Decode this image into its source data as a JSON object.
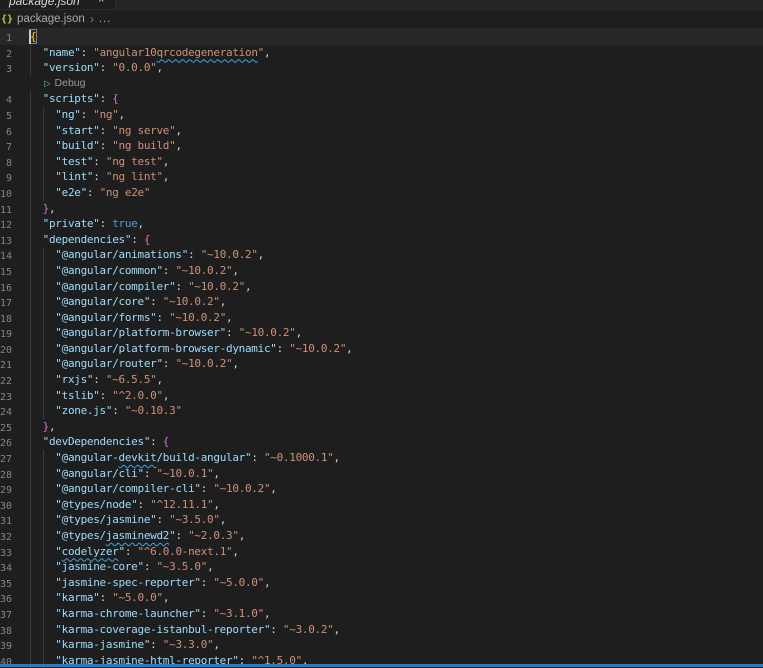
{
  "window": {
    "background": "#1e1e1e"
  },
  "tab_bar": {
    "tabs": [
      {
        "title": "package.json",
        "close_icon": "×",
        "active": true,
        "preview_italic": true
      }
    ]
  },
  "breadcrumb": {
    "file_icon": "{}",
    "file_name": "package.json",
    "separator": "›",
    "symbol_ellipsis": "..."
  },
  "codelens": {
    "icon": "▷",
    "label": "Debug"
  },
  "editor": {
    "language": "json",
    "rows": [
      {
        "t": "code",
        "n": "1",
        "g": 0,
        "cur": true,
        "tk": [
          [
            "b1 match",
            "{"
          ]
        ]
      },
      {
        "t": "code",
        "n": "2",
        "g": 1,
        "tk": [
          [
            "w",
            "  "
          ],
          [
            "k",
            "\"name\""
          ],
          [
            "p",
            ": "
          ],
          [
            "s",
            "\"angular10"
          ],
          [
            "s sq",
            "qrcodegeneration"
          ],
          [
            "s",
            "\""
          ],
          [
            "p",
            ","
          ]
        ]
      },
      {
        "t": "code",
        "n": "3",
        "g": 1,
        "tk": [
          [
            "w",
            "  "
          ],
          [
            "k",
            "\"version\""
          ],
          [
            "p",
            ": "
          ],
          [
            "s",
            "\"0.0.0\""
          ],
          [
            "p",
            ","
          ]
        ]
      },
      {
        "t": "lens"
      },
      {
        "t": "code",
        "n": "4",
        "g": 1,
        "tk": [
          [
            "w",
            "  "
          ],
          [
            "k",
            "\"scripts\""
          ],
          [
            "p",
            ": "
          ],
          [
            "b2",
            "{"
          ]
        ]
      },
      {
        "t": "code",
        "n": "5",
        "g": 2,
        "tk": [
          [
            "w",
            "    "
          ],
          [
            "k",
            "\"ng\""
          ],
          [
            "p",
            ": "
          ],
          [
            "s",
            "\"ng\""
          ],
          [
            "p",
            ","
          ]
        ]
      },
      {
        "t": "code",
        "n": "6",
        "g": 2,
        "tk": [
          [
            "w",
            "    "
          ],
          [
            "k",
            "\"start\""
          ],
          [
            "p",
            ": "
          ],
          [
            "s",
            "\"ng serve\""
          ],
          [
            "p",
            ","
          ]
        ]
      },
      {
        "t": "code",
        "n": "7",
        "g": 2,
        "tk": [
          [
            "w",
            "    "
          ],
          [
            "k",
            "\"build\""
          ],
          [
            "p",
            ": "
          ],
          [
            "s",
            "\"ng build\""
          ],
          [
            "p",
            ","
          ]
        ]
      },
      {
        "t": "code",
        "n": "8",
        "g": 2,
        "tk": [
          [
            "w",
            "    "
          ],
          [
            "k",
            "\"test\""
          ],
          [
            "p",
            ": "
          ],
          [
            "s",
            "\"ng test\""
          ],
          [
            "p",
            ","
          ]
        ]
      },
      {
        "t": "code",
        "n": "9",
        "g": 2,
        "tk": [
          [
            "w",
            "    "
          ],
          [
            "k",
            "\"lint\""
          ],
          [
            "p",
            ": "
          ],
          [
            "s",
            "\"ng lint\""
          ],
          [
            "p",
            ","
          ]
        ]
      },
      {
        "t": "code",
        "n": "10",
        "g": 2,
        "tk": [
          [
            "w",
            "    "
          ],
          [
            "k",
            "\"e2e\""
          ],
          [
            "p",
            ": "
          ],
          [
            "s",
            "\"ng e2e\""
          ]
        ]
      },
      {
        "t": "code",
        "n": "11",
        "g": 1,
        "tk": [
          [
            "w",
            "  "
          ],
          [
            "b2",
            "}"
          ],
          [
            "p",
            ","
          ]
        ]
      },
      {
        "t": "code",
        "n": "12",
        "g": 1,
        "tk": [
          [
            "w",
            "  "
          ],
          [
            "k",
            "\"private\""
          ],
          [
            "p",
            ": "
          ],
          [
            "b",
            "true"
          ],
          [
            "p",
            ","
          ]
        ]
      },
      {
        "t": "code",
        "n": "13",
        "g": 1,
        "tk": [
          [
            "w",
            "  "
          ],
          [
            "k",
            "\"dependencies\""
          ],
          [
            "p",
            ": "
          ],
          [
            "b2",
            "{"
          ]
        ]
      },
      {
        "t": "code",
        "n": "14",
        "g": 2,
        "tk": [
          [
            "w",
            "    "
          ],
          [
            "k",
            "\"@angular/animations\""
          ],
          [
            "p",
            ": "
          ],
          [
            "s",
            "\"~10.0.2\""
          ],
          [
            "p",
            ","
          ]
        ]
      },
      {
        "t": "code",
        "n": "15",
        "g": 2,
        "tk": [
          [
            "w",
            "    "
          ],
          [
            "k",
            "\"@angular/common\""
          ],
          [
            "p",
            ": "
          ],
          [
            "s",
            "\"~10.0.2\""
          ],
          [
            "p",
            ","
          ]
        ]
      },
      {
        "t": "code",
        "n": "16",
        "g": 2,
        "tk": [
          [
            "w",
            "    "
          ],
          [
            "k",
            "\"@angular/compiler\""
          ],
          [
            "p",
            ": "
          ],
          [
            "s",
            "\"~10.0.2\""
          ],
          [
            "p",
            ","
          ]
        ]
      },
      {
        "t": "code",
        "n": "17",
        "g": 2,
        "tk": [
          [
            "w",
            "    "
          ],
          [
            "k",
            "\"@angular/core\""
          ],
          [
            "p",
            ": "
          ],
          [
            "s",
            "\"~10.0.2\""
          ],
          [
            "p",
            ","
          ]
        ]
      },
      {
        "t": "code",
        "n": "18",
        "g": 2,
        "tk": [
          [
            "w",
            "    "
          ],
          [
            "k",
            "\"@angular/forms\""
          ],
          [
            "p",
            ": "
          ],
          [
            "s",
            "\"~10.0.2\""
          ],
          [
            "p",
            ","
          ]
        ]
      },
      {
        "t": "code",
        "n": "19",
        "g": 2,
        "tk": [
          [
            "w",
            "    "
          ],
          [
            "k",
            "\"@angular/platform-browser\""
          ],
          [
            "p",
            ": "
          ],
          [
            "s",
            "\"~10.0.2\""
          ],
          [
            "p",
            ","
          ]
        ]
      },
      {
        "t": "code",
        "n": "20",
        "g": 2,
        "tk": [
          [
            "w",
            "    "
          ],
          [
            "k",
            "\"@angular/platform-browser-dynamic\""
          ],
          [
            "p",
            ": "
          ],
          [
            "s",
            "\"~10.0.2\""
          ],
          [
            "p",
            ","
          ]
        ]
      },
      {
        "t": "code",
        "n": "21",
        "g": 2,
        "tk": [
          [
            "w",
            "    "
          ],
          [
            "k",
            "\"@angular/router\""
          ],
          [
            "p",
            ": "
          ],
          [
            "s",
            "\"~10.0.2\""
          ],
          [
            "p",
            ","
          ]
        ]
      },
      {
        "t": "code",
        "n": "22",
        "g": 2,
        "tk": [
          [
            "w",
            "    "
          ],
          [
            "k",
            "\"rxjs\""
          ],
          [
            "p",
            ": "
          ],
          [
            "s",
            "\"~6.5.5\""
          ],
          [
            "p",
            ","
          ]
        ]
      },
      {
        "t": "code",
        "n": "23",
        "g": 2,
        "tk": [
          [
            "w",
            "    "
          ],
          [
            "k",
            "\"tslib\""
          ],
          [
            "p",
            ": "
          ],
          [
            "s",
            "\"^2.0.0\""
          ],
          [
            "p",
            ","
          ]
        ]
      },
      {
        "t": "code",
        "n": "24",
        "g": 2,
        "tk": [
          [
            "w",
            "    "
          ],
          [
            "k",
            "\"zone.js\""
          ],
          [
            "p",
            ": "
          ],
          [
            "s",
            "\"~0.10.3\""
          ]
        ]
      },
      {
        "t": "code",
        "n": "25",
        "g": 1,
        "tk": [
          [
            "w",
            "  "
          ],
          [
            "b2",
            "}"
          ],
          [
            "p",
            ","
          ]
        ]
      },
      {
        "t": "code",
        "n": "26",
        "g": 1,
        "tk": [
          [
            "w",
            "  "
          ],
          [
            "k",
            "\"devDependencies\""
          ],
          [
            "p",
            ": "
          ],
          [
            "b2",
            "{"
          ]
        ]
      },
      {
        "t": "code",
        "n": "27",
        "g": 2,
        "tk": [
          [
            "w",
            "    "
          ],
          [
            "k",
            "\"@angular-"
          ],
          [
            "k sq",
            "devkit"
          ],
          [
            "k",
            "/build-angular\""
          ],
          [
            "p",
            ": "
          ],
          [
            "s",
            "\"~0.1000.1\""
          ],
          [
            "p",
            ","
          ]
        ]
      },
      {
        "t": "code",
        "n": "28",
        "g": 2,
        "tk": [
          [
            "w",
            "    "
          ],
          [
            "k",
            "\"@angular/cli\""
          ],
          [
            "p",
            ": "
          ],
          [
            "s",
            "\"~10.0.1\""
          ],
          [
            "p",
            ","
          ]
        ]
      },
      {
        "t": "code",
        "n": "29",
        "g": 2,
        "tk": [
          [
            "w",
            "    "
          ],
          [
            "k",
            "\"@angular/compiler-cli\""
          ],
          [
            "p",
            ": "
          ],
          [
            "s",
            "\"~10.0.2\""
          ],
          [
            "p",
            ","
          ]
        ]
      },
      {
        "t": "code",
        "n": "30",
        "g": 2,
        "tk": [
          [
            "w",
            "    "
          ],
          [
            "k",
            "\"@types/node\""
          ],
          [
            "p",
            ": "
          ],
          [
            "s",
            "\"^12.11.1\""
          ],
          [
            "p",
            ","
          ]
        ]
      },
      {
        "t": "code",
        "n": "31",
        "g": 2,
        "tk": [
          [
            "w",
            "    "
          ],
          [
            "k",
            "\"@types/jasmine\""
          ],
          [
            "p",
            ": "
          ],
          [
            "s",
            "\"~3.5.0\""
          ],
          [
            "p",
            ","
          ]
        ]
      },
      {
        "t": "code",
        "n": "32",
        "g": 2,
        "tk": [
          [
            "w",
            "    "
          ],
          [
            "k",
            "\"@types/"
          ],
          [
            "k sq",
            "jasminewd2"
          ],
          [
            "k",
            "\""
          ],
          [
            "p",
            ": "
          ],
          [
            "s",
            "\"~2.0.3\""
          ],
          [
            "p",
            ","
          ]
        ]
      },
      {
        "t": "code",
        "n": "33",
        "g": 2,
        "tk": [
          [
            "w",
            "    "
          ],
          [
            "k",
            "\""
          ],
          [
            "k sq",
            "codelyzer"
          ],
          [
            "k",
            "\""
          ],
          [
            "p",
            ": "
          ],
          [
            "s",
            "\"^6.0.0-next.1\""
          ],
          [
            "p",
            ","
          ]
        ]
      },
      {
        "t": "code",
        "n": "34",
        "g": 2,
        "tk": [
          [
            "w",
            "    "
          ],
          [
            "k",
            "\"jasmine-core\""
          ],
          [
            "p",
            ": "
          ],
          [
            "s",
            "\"~3.5.0\""
          ],
          [
            "p",
            ","
          ]
        ]
      },
      {
        "t": "code",
        "n": "35",
        "g": 2,
        "tk": [
          [
            "w",
            "    "
          ],
          [
            "k",
            "\"jasmine-spec-reporter\""
          ],
          [
            "p",
            ": "
          ],
          [
            "s",
            "\"~5.0.0\""
          ],
          [
            "p",
            ","
          ]
        ]
      },
      {
        "t": "code",
        "n": "36",
        "g": 2,
        "tk": [
          [
            "w",
            "    "
          ],
          [
            "k",
            "\"karma\""
          ],
          [
            "p",
            ": "
          ],
          [
            "s",
            "\"~5.0.0\""
          ],
          [
            "p",
            ","
          ]
        ]
      },
      {
        "t": "code",
        "n": "37",
        "g": 2,
        "tk": [
          [
            "w",
            "    "
          ],
          [
            "k",
            "\"karma-chrome-launcher\""
          ],
          [
            "p",
            ": "
          ],
          [
            "s",
            "\"~3.1.0\""
          ],
          [
            "p",
            ","
          ]
        ]
      },
      {
        "t": "code",
        "n": "38",
        "g": 2,
        "tk": [
          [
            "w",
            "    "
          ],
          [
            "k",
            "\"karma-coverage-istanbul-reporter\""
          ],
          [
            "p",
            ": "
          ],
          [
            "s",
            "\"~3.0.2\""
          ],
          [
            "p",
            ","
          ]
        ]
      },
      {
        "t": "code",
        "n": "39",
        "g": 2,
        "tk": [
          [
            "w",
            "    "
          ],
          [
            "k",
            "\"karma-jasmine\""
          ],
          [
            "p",
            ": "
          ],
          [
            "s",
            "\"~3.3.0\""
          ],
          [
            "p",
            ","
          ]
        ]
      },
      {
        "t": "code",
        "n": "40",
        "g": 2,
        "tk": [
          [
            "w",
            "    "
          ],
          [
            "k",
            "\"karma-jasmine-html-reporter\""
          ],
          [
            "p",
            ": "
          ],
          [
            "s",
            "\"^1.5.0\""
          ],
          [
            "p",
            ","
          ]
        ]
      }
    ]
  },
  "colors": {
    "editor_background": "#1e1e1e",
    "tabbar_background": "#252526",
    "key": "#9cdcfe",
    "string": "#ce9178",
    "keyword_true": "#569cd6",
    "brace_level1": "#ffd700",
    "brace_level2": "#da70d6",
    "line_number": "#858585",
    "squiggle_info": "#3ea4e5",
    "codelens_text": "#999999",
    "codelens_play": "#74c991",
    "bottom_border_blue": "#1b7ed3",
    "breadcrumb_text": "#a9a9a9",
    "json_icon": "#cbcb41"
  }
}
